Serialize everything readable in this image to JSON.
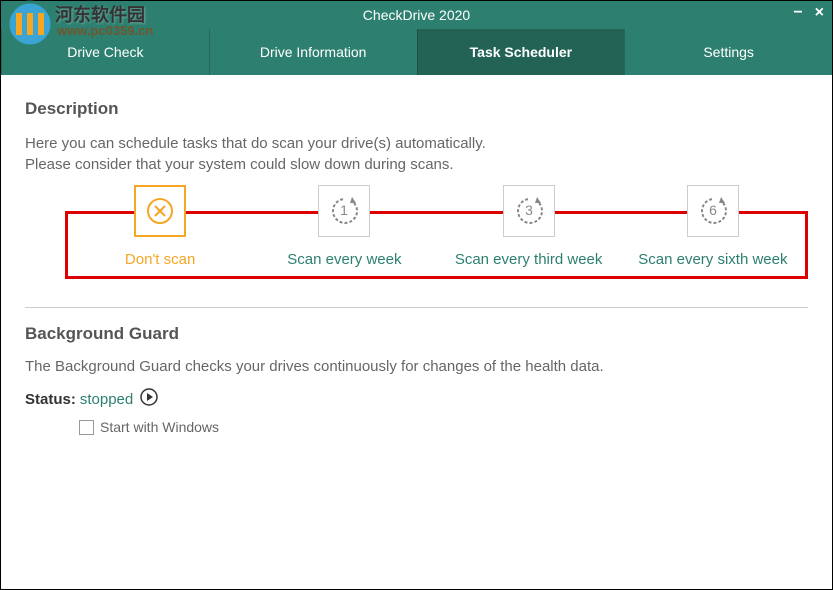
{
  "app": {
    "title": "CheckDrive 2020"
  },
  "watermark": {
    "main": "河东软件园",
    "sub": "www.pc0359.cn"
  },
  "tabs": [
    {
      "label": "Drive Check",
      "active": false
    },
    {
      "label": "Drive Information",
      "active": false
    },
    {
      "label": "Task Scheduler",
      "active": true
    },
    {
      "label": "Settings",
      "active": false
    }
  ],
  "description": {
    "title": "Description",
    "line1": "Here you can schedule tasks that do scan your drive(s) automatically.",
    "line2": "Please consider that your system could slow down during scans."
  },
  "options": [
    {
      "label": "Don't scan",
      "selected": true,
      "icon": "x"
    },
    {
      "label": "Scan every week",
      "selected": false,
      "icon": "1"
    },
    {
      "label": "Scan every third week",
      "selected": false,
      "icon": "3"
    },
    {
      "label": "Scan every sixth week",
      "selected": false,
      "icon": "6"
    }
  ],
  "background": {
    "title": "Background Guard",
    "text": "The Background Guard checks your drives continuously for changes of the health data.",
    "status_label": "Status:",
    "status_value": "stopped",
    "checkbox_label": "Start with Windows"
  }
}
